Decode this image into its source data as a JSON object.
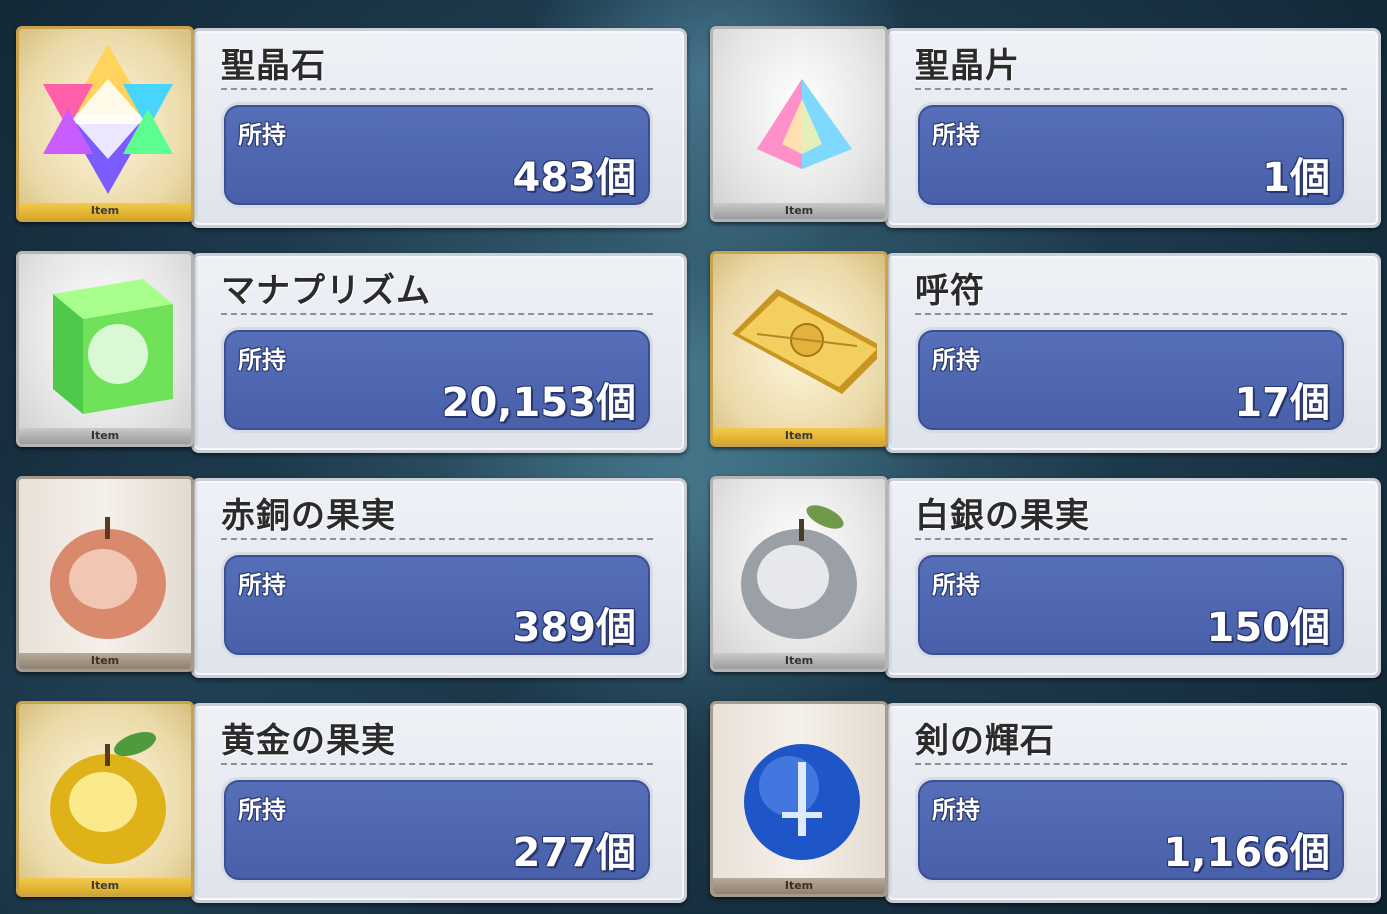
{
  "owned_label": "所持",
  "thumb_tag": "Item",
  "items": [
    {
      "name": "聖晶石",
      "count": "483個",
      "icon": "saint-quartz-icon",
      "frame": "gold"
    },
    {
      "name": "聖晶片",
      "count": "1個",
      "icon": "saint-quartz-fragment-icon",
      "frame": "silver"
    },
    {
      "name": "マナプリズム",
      "count": "20,153個",
      "icon": "mana-prism-icon",
      "frame": "silver"
    },
    {
      "name": "呼符",
      "count": "17個",
      "icon": "summon-ticket-icon",
      "frame": "gold"
    },
    {
      "name": "赤銅の果実",
      "count": "389個",
      "icon": "bronze-apple-icon",
      "frame": "bronze"
    },
    {
      "name": "白銀の果実",
      "count": "150個",
      "icon": "silver-apple-icon",
      "frame": "silver"
    },
    {
      "name": "黄金の果実",
      "count": "277個",
      "icon": "golden-apple-icon",
      "frame": "gold"
    },
    {
      "name": "剣の輝石",
      "count": "1,166個",
      "icon": "saber-gem-icon",
      "frame": "bronze"
    }
  ]
}
